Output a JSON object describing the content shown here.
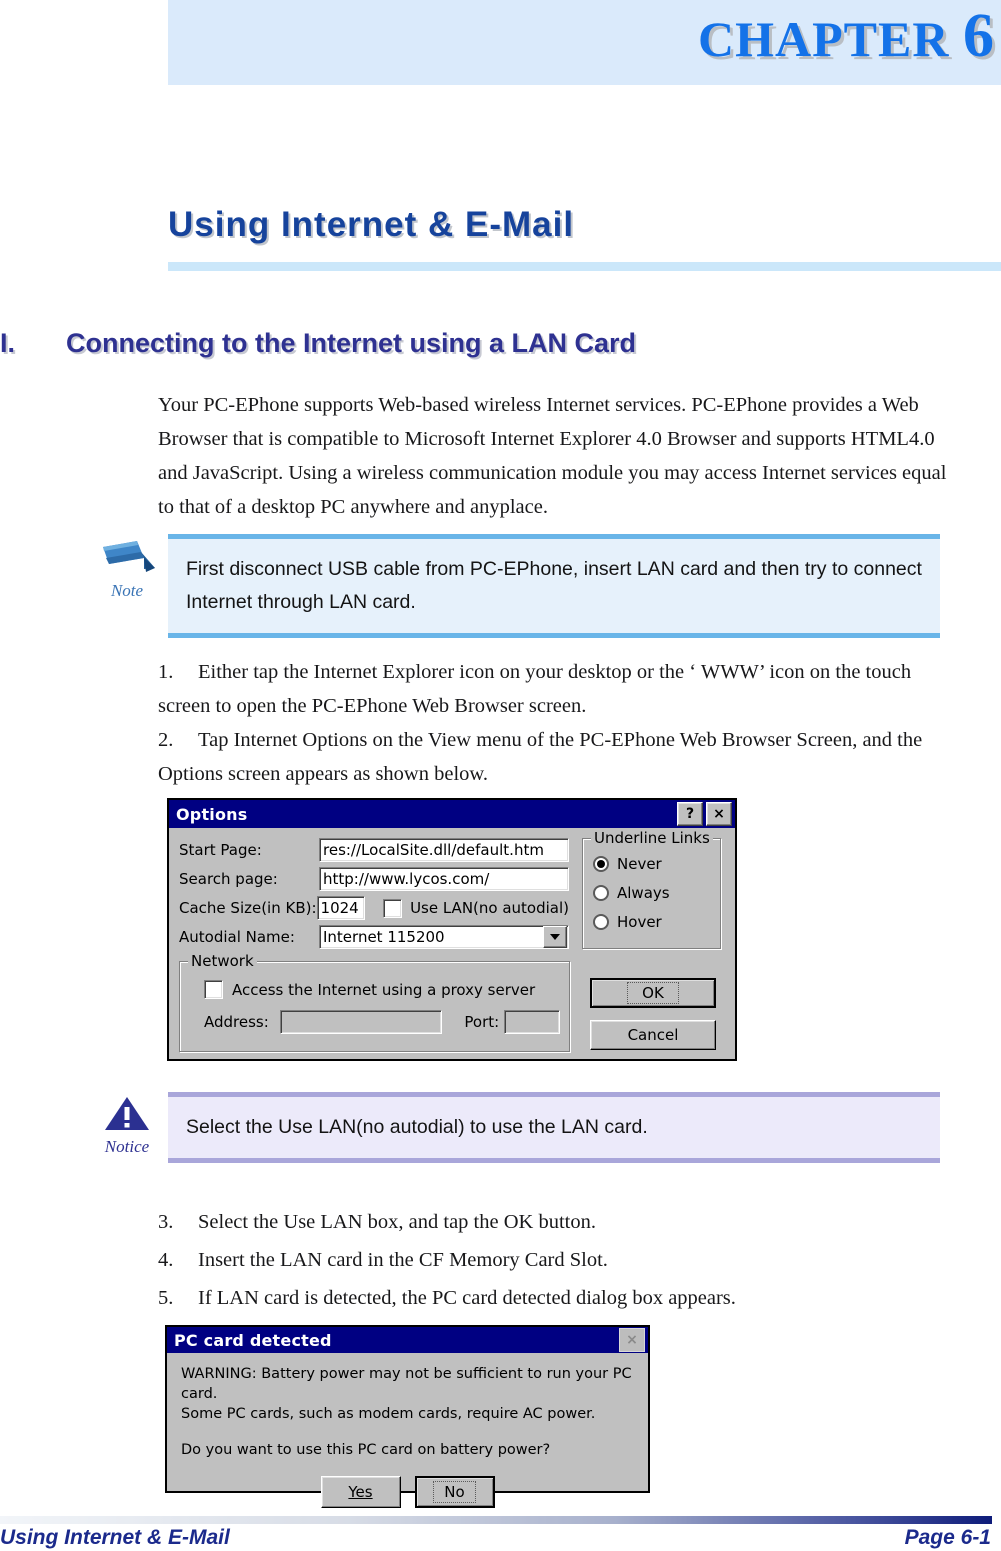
{
  "header": {
    "chapter_label": "CHAPTER",
    "chapter_number": "6",
    "band_color": "#daeafb",
    "chapter_color": "#1472e8"
  },
  "doc_title": "Using Internet & E-Mail",
  "section": {
    "number": "I.",
    "title": "Connecting to the Internet using a LAN Card"
  },
  "intro_paragraph": "Your PC-EPhone supports Web-based wireless Internet services. PC-EPhone provides a Web Browser that is compatible to Microsoft Internet Explorer 4.0 Browser and supports HTML4.0 and JavaScript. Using a wireless communication module you may access Internet services equal to that of a desktop PC anywhere and anyplace.",
  "note": {
    "tag": "Note",
    "icon": "pencil-icon",
    "text": "First disconnect USB cable from PC-EPhone, insert LAN card and then try to connect Internet through LAN card.",
    "accent_color": "#69b5e8",
    "background": "#e6f1fb"
  },
  "notice": {
    "tag": "Notice",
    "icon": "warning-triangle-icon",
    "text": "Select the Use LAN(no autodial) to use the LAN card.",
    "accent_color": "#a9a6da",
    "background": "#eceafa"
  },
  "steps": [
    {
      "number": "1.",
      "text": "Either tap the Internet Explorer icon on your desktop or the ‘ WWW’  icon on the touch screen to open the PC-EPhone Web Browser screen."
    },
    {
      "number": "2.",
      "text": "Tap Internet Options on the View menu of the PC-EPhone Web Browser Screen, and the Options screen appears as shown below."
    },
    {
      "number": "3.",
      "text": "Select the Use LAN box, and tap the OK button."
    },
    {
      "number": "4.",
      "text": "Insert the LAN card in the CF Memory Card Slot."
    },
    {
      "number": "5.",
      "text": "If LAN card is detected, the PC card detected dialog box appears."
    }
  ],
  "options_dialog": {
    "title": "Options",
    "help_button": "?",
    "close_button": "×",
    "fields": {
      "start_page_label": "Start Page:",
      "start_page_value": "res://LocalSite.dll/default.htm",
      "search_page_label": "Search page:",
      "search_page_value": "http://www.lycos.com/",
      "cache_size_label": "Cache Size(in KB):",
      "cache_size_value": "1024",
      "use_lan_label": "Use LAN(no autodial)",
      "use_lan_checked": false,
      "autodial_label": "Autodial Name:",
      "autodial_value": "Internet 115200"
    },
    "network_group": {
      "legend": "Network",
      "proxy_label": "Access the Internet using a proxy server",
      "proxy_checked": false,
      "address_label": "Address:",
      "address_value": "",
      "port_label": "Port:",
      "port_value": ""
    },
    "underline_links": {
      "legend": "Underline Links",
      "options": [
        "Never",
        "Always",
        "Hover"
      ],
      "selected": "Never"
    },
    "buttons": {
      "ok": "OK",
      "cancel": "Cancel"
    }
  },
  "pc_card_dialog": {
    "title": "PC card detected",
    "close_button": "×",
    "line1": "WARNING: Battery power may not be sufficient to run your PC card.",
    "line2": "Some PC cards, such as modem cards, require AC power.",
    "line3": "Do you want to use this PC card on battery power?",
    "yes_button": "Yes",
    "no_button": "No",
    "default_button": "No"
  },
  "footer": {
    "left": "Using Internet & E-Mail",
    "right": "Page 6-1"
  }
}
